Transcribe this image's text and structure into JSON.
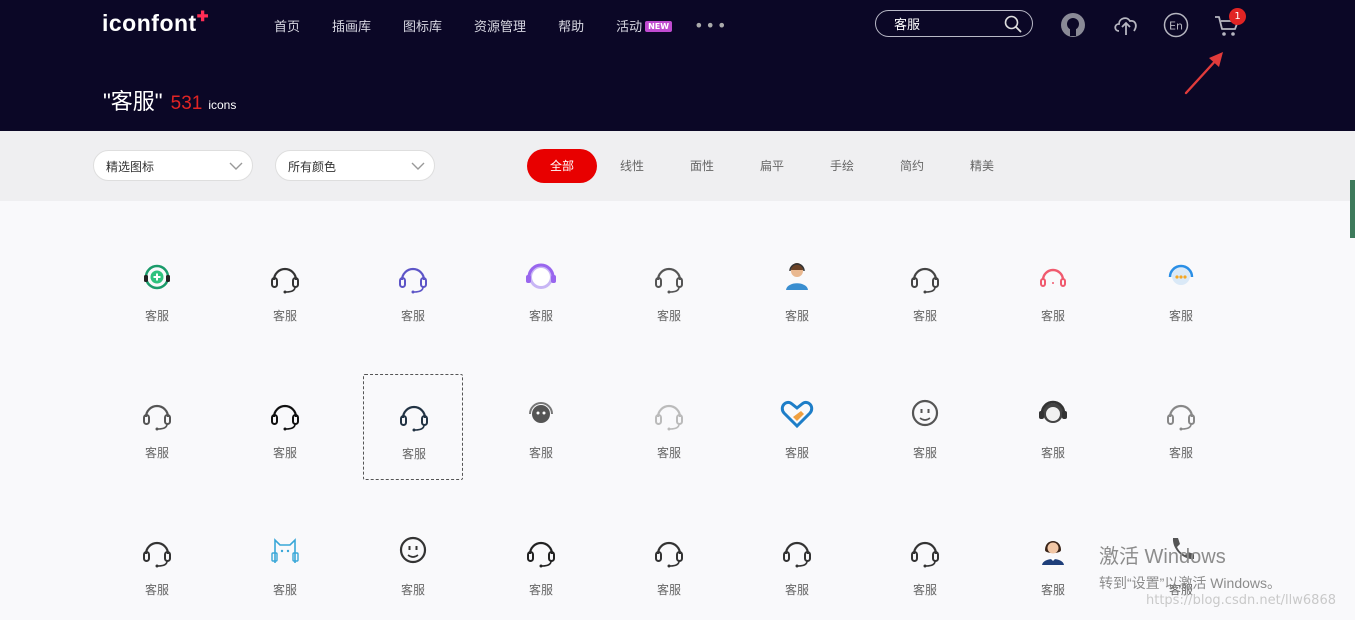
{
  "header": {
    "logo": "iconfont",
    "nav": [
      {
        "label": "首页"
      },
      {
        "label": "插画库"
      },
      {
        "label": "图标库"
      },
      {
        "label": "资源管理"
      },
      {
        "label": "帮助"
      },
      {
        "label": "活动",
        "badge": "NEW"
      }
    ],
    "more": "•••",
    "search": {
      "value": "客服"
    },
    "lang": "En",
    "cart_count": "1"
  },
  "result": {
    "query_label": "\"客服\"",
    "count": "531",
    "unit": "icons"
  },
  "filters": {
    "select1": "精选图标",
    "select2": "所有颜色",
    "tabs": [
      "全部",
      "线性",
      "面性",
      "扁平",
      "手绘",
      "简约",
      "精美"
    ],
    "active_tab": "全部"
  },
  "icons": [
    {
      "label": "客服",
      "icon": "headset-plus-icon",
      "color": "#1a9b6a"
    },
    {
      "label": "客服",
      "icon": "headphones-outline-icon",
      "color": "#333333"
    },
    {
      "label": "客服",
      "icon": "headset-mic-icon",
      "color": "#5d55c7"
    },
    {
      "label": "客服",
      "icon": "headset-face-purple-icon",
      "color": "#9966ee"
    },
    {
      "label": "客服",
      "icon": "headset-outline-icon",
      "color": "#555555"
    },
    {
      "label": "客服",
      "icon": "support-agent-avatar-icon",
      "color": "#3a8ed0"
    },
    {
      "label": "客服",
      "icon": "smiley-headset-icon",
      "color": "#444444"
    },
    {
      "label": "客服",
      "icon": "headset-pink-icon",
      "color": "#f05a6e"
    },
    {
      "label": "客服",
      "icon": "chat-headset-blue-icon",
      "color": "#2a8fe6"
    },
    {
      "label": "客服",
      "icon": "agent-face-icon",
      "color": "#555555"
    },
    {
      "label": "客服",
      "icon": "headphones-bold-icon",
      "color": "#111111"
    },
    {
      "label": "客服",
      "icon": "headset-teal-icon",
      "color": "#234"
    },
    {
      "label": "客服",
      "icon": "robot-headset-icon",
      "color": "#555555"
    },
    {
      "label": "客服",
      "icon": "headset-light-gray-icon",
      "color": "#bbbbbb"
    },
    {
      "label": "客服",
      "icon": "heart-hands-icon",
      "color": "#1e7ec8"
    },
    {
      "label": "客服",
      "icon": "face-circle-icon",
      "color": "#555555"
    },
    {
      "label": "客服",
      "icon": "agent-dark-avatar-icon",
      "color": "#444444"
    },
    {
      "label": "客服",
      "icon": "headset-gray-icon",
      "color": "#888888"
    },
    {
      "label": "客服",
      "icon": "headset-round-icon",
      "color": "#333333"
    },
    {
      "label": "客服",
      "icon": "cat-headset-icon",
      "color": "#39a7d8"
    },
    {
      "label": "客服",
      "icon": "smile-headset-icon",
      "color": "#333333"
    },
    {
      "label": "客服",
      "icon": "person-headset-icon",
      "color": "#222222"
    },
    {
      "label": "客服",
      "icon": "headset-mic-outline-icon",
      "color": "#333333"
    },
    {
      "label": "客服",
      "icon": "headset-chat-icon",
      "color": "#333333"
    },
    {
      "label": "客服",
      "icon": "headset-side-icon",
      "color": "#333333"
    },
    {
      "label": "客服",
      "icon": "woman-agent-icon",
      "color": "#333333"
    },
    {
      "label": "客服",
      "icon": "phone-icon",
      "color": "#555555"
    }
  ],
  "overlay": {
    "watermark_line1": "激活 Windows",
    "watermark_line2": "转到“设置”以激活 Windows。",
    "source": "https://blog.csdn.net/llw6868"
  }
}
